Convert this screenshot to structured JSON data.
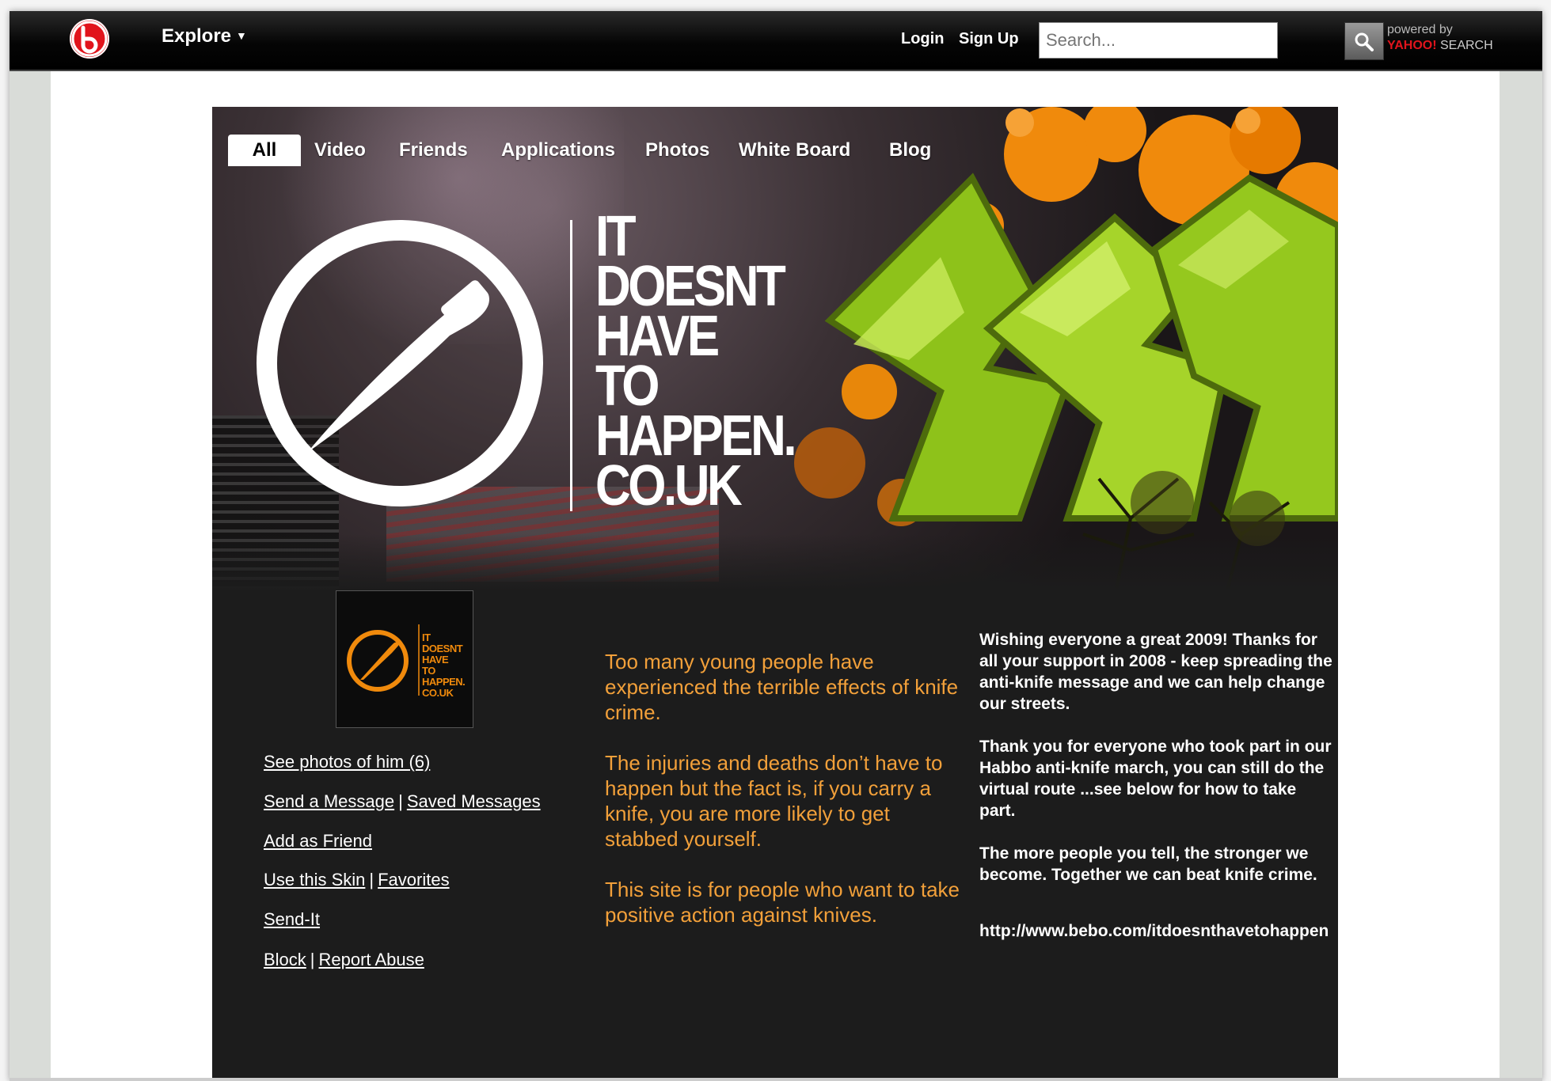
{
  "topbar": {
    "explore_label": "Explore",
    "login_label": "Login",
    "signup_label": "Sign Up",
    "search_placeholder": "Search...",
    "powered_by": "powered by",
    "yahoo": "YAHOO!",
    "search_word": "SEARCH"
  },
  "tabs": [
    "All",
    "Video",
    "Friends",
    "Applications",
    "Photos",
    "White Board",
    "Blog"
  ],
  "banner": {
    "slogan": [
      "IT",
      "DOESNT",
      "HAVE",
      "TO",
      "HAPPEN.",
      "CO.UK"
    ]
  },
  "thumbnail": {
    "slogan": [
      "IT",
      "DOESNT",
      "HAVE",
      "TO",
      "HAPPEN.",
      "CO.UK"
    ]
  },
  "profile_links": {
    "see_photos": "See photos of him (6)",
    "send_message": "Send a Message",
    "saved_messages": "Saved Messages",
    "add_friend": "Add as Friend",
    "use_skin": "Use this Skin",
    "favorites": "Favorites",
    "send_it": "Send-It",
    "block": "Block",
    "report_abuse": "Report Abuse",
    "separator": "|"
  },
  "orange_text": [
    "Too many young people have experienced the terrible effects of knife crime.",
    "The injuries and deaths don’t have to happen but the fact is, if you carry a knife, you are more likely to get stabbed yourself.",
    "This site is for people who want to take positive action against knives."
  ],
  "white_text": [
    "Wishing everyone a great 2009! Thanks for all your support in 2008 - keep spreading the anti-knife message and we can help change our streets.",
    "Thank you for everyone who took part in our Habbo anti-knife march, you can still do the virtual route ...see below for how to take part.",
    "The more people you tell, the stronger we become. Together we can beat knife crime."
  ],
  "profile_url": "http://www.bebo.com/itdoesnthavetohappen",
  "colors": {
    "brand_red": "#e1141c",
    "orange_text": "#f2a03a",
    "graffiti_green": "#9ccc1a",
    "graffiti_orange": "#f08a0c",
    "content_bg": "#1c1c1c"
  }
}
